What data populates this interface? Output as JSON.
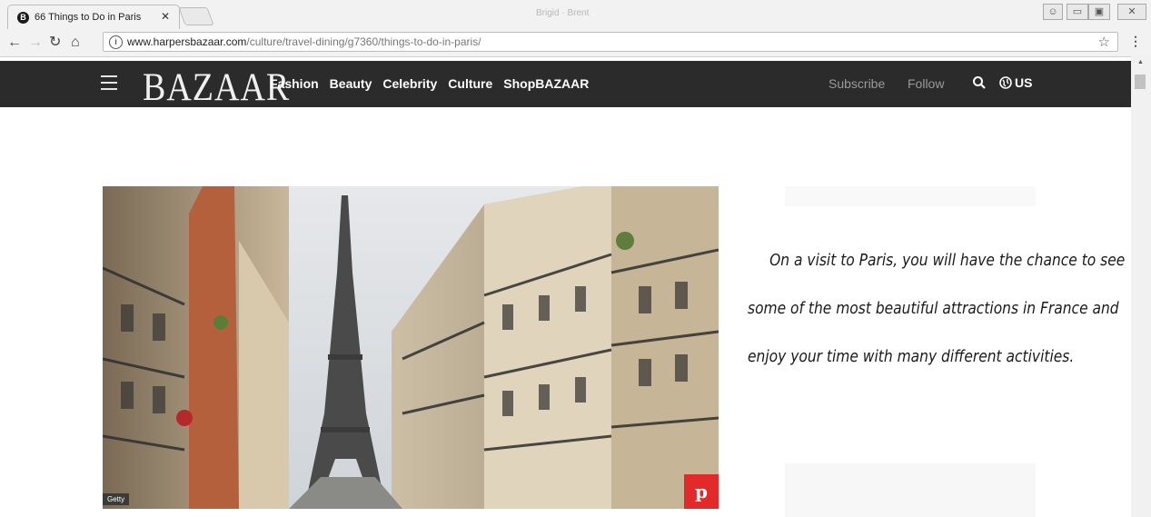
{
  "browser": {
    "tab_title": "66 Things to Do in Paris",
    "tab_favicon_letter": "B",
    "window_title": "Brigid · Brent",
    "url_host": "www.harpersbazaar.com",
    "url_path": "/culture/travel-dining/g7360/things-to-do-in-paris/",
    "icons": {
      "back": "back-arrow-icon",
      "forward": "forward-arrow-icon",
      "reload": "reload-icon",
      "home": "home-icon",
      "info": "info-icon",
      "bookmark": "star-icon",
      "menu": "kebab-menu-icon"
    }
  },
  "site": {
    "logo": "BAZAAR",
    "nav": [
      "Fashion",
      "Beauty",
      "Celebrity",
      "Culture",
      "ShopBAZAAR"
    ],
    "subscribe": "Subscribe",
    "follow": "Follow",
    "region": "US",
    "header_bg": "#2b2b2b"
  },
  "hero": {
    "credit": "Getty",
    "pin_glyph": "p",
    "pin_color": "#e22a2a",
    "image_subject": "Eiffel Tower viewed down a Paris street lined with Haussmann buildings"
  },
  "article": {
    "intro": "On a visit to Paris, you will have the chance to see some of the most beautiful attractions in France and enjoy your time with many different activities."
  }
}
